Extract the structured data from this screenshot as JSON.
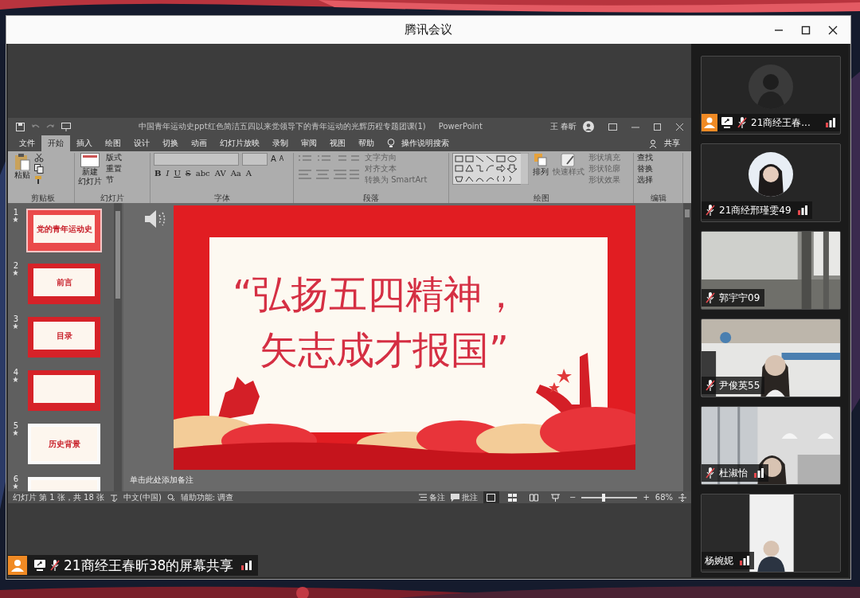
{
  "meeting": {
    "title": "腾讯会议"
  },
  "ppt": {
    "title": "中国青年运动史ppt红色简洁五四以来党领导下的青年运动的光辉历程专题团课(1)",
    "app": "PowerPoint",
    "user": "王 春昕",
    "tabs": [
      {
        "label": "文件",
        "selected": false
      },
      {
        "label": "开始",
        "selected": true
      },
      {
        "label": "插入",
        "selected": false
      },
      {
        "label": "绘图",
        "selected": false
      },
      {
        "label": "设计",
        "selected": false
      },
      {
        "label": "切换",
        "selected": false
      },
      {
        "label": "动画",
        "selected": false
      },
      {
        "label": "幻灯片放映",
        "selected": false
      },
      {
        "label": "录制",
        "selected": false
      },
      {
        "label": "审阅",
        "selected": false
      },
      {
        "label": "视图",
        "selected": false
      },
      {
        "label": "帮助",
        "selected": false
      }
    ],
    "search": "操作说明搜索",
    "share": "共享",
    "ribbon": {
      "clipboard": {
        "label": "剪贴板",
        "paste": "粘贴"
      },
      "slides": {
        "label": "幻灯片",
        "new_slide": [
          "新建",
          "幻灯片"
        ],
        "items": [
          "版式",
          "重置",
          "节"
        ]
      },
      "font": {
        "label": "字体",
        "sizes": [
          "A",
          "A"
        ],
        "formats": [
          "B",
          "I",
          "U",
          "S",
          "abc",
          "AV",
          "Aa",
          "A"
        ]
      },
      "paragraph": {
        "label": "段落",
        "items": [
          "文字方向",
          "对齐文本",
          "转换为 SmartArt"
        ]
      },
      "drawing": {
        "label": "绘图",
        "arrange": "排列",
        "quick_styles": "快速样式",
        "items": [
          "形状填充",
          "形状轮廓",
          "形状效果"
        ]
      },
      "editing": {
        "label": "编辑",
        "items": [
          "查找",
          "替换",
          "选择"
        ]
      }
    },
    "thumbnails": [
      {
        "number": "1",
        "kind": "red",
        "title": "党的青年运动史",
        "selected": true
      },
      {
        "number": "2",
        "kind": "red",
        "title": "前言",
        "selected": false
      },
      {
        "number": "3",
        "kind": "red",
        "title": "目录",
        "selected": false
      },
      {
        "number": "4",
        "kind": "red",
        "selected": false
      },
      {
        "number": "5",
        "kind": "white",
        "title": "历史背景",
        "selected": false
      },
      {
        "number": "6",
        "kind": "white",
        "selected": false
      }
    ],
    "slide": {
      "lines": [
        "“弘扬五四精神，",
        "矢志成才报国”"
      ]
    },
    "notes_placeholder": "单击此处添加备注",
    "status": {
      "slide_count": "幻灯片 第 1 张，共 18 张",
      "language": "中文(中国)",
      "accessibility": "辅助功能: 调查",
      "notes": "备注",
      "comments": "批注",
      "views": [
        {
          "selected": true
        },
        {
          "selected": false
        },
        {
          "selected": false
        },
        {
          "selected": false
        }
      ],
      "zoom_out": "−",
      "zoom_slider": {
        "level": 0.4
      },
      "zoom_in": "+",
      "zoom": "68%"
    }
  },
  "participants": [
    {
      "name": "21商经王春...",
      "kind": "avatar",
      "host": true,
      "sharing": true,
      "muted": true,
      "signal": true
    },
    {
      "name": "21商经邢瑾雯49",
      "kind": "avatar",
      "host": false,
      "sharing": false,
      "muted": true,
      "signal": true
    },
    {
      "name": "郭宇宁09",
      "kind": "video",
      "host": false,
      "sharing": false,
      "muted": true,
      "signal": false
    },
    {
      "name": "尹俊英55",
      "kind": "video",
      "host": false,
      "sharing": false,
      "muted": true,
      "signal": false
    },
    {
      "name": "杜淑怡",
      "kind": "video",
      "host": false,
      "sharing": false,
      "muted": true,
      "signal": true
    },
    {
      "name": "杨婉妮",
      "kind": "video",
      "host": false,
      "sharing": false,
      "muted": false,
      "signal": true
    }
  ],
  "share_bar": {
    "label": "21商经王春昕38的屏幕共享",
    "host": true,
    "sharing": true,
    "muted": true,
    "signal": true
  }
}
